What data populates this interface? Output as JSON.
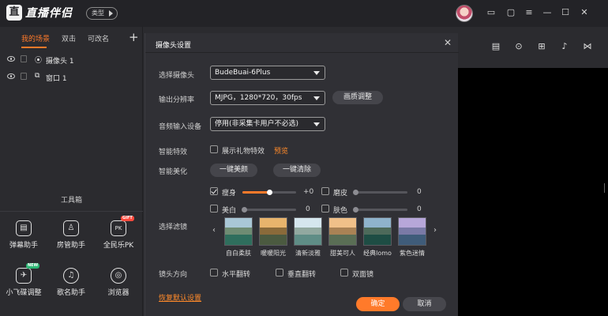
{
  "app": {
    "logo_glyph": "直",
    "name": "直播伴侣",
    "type_label": "类型"
  },
  "titlebar_icons": [
    "screen-icon",
    "window-icon",
    "menu-icon",
    "minimize-icon",
    "maximize-icon",
    "close-icon"
  ],
  "titlebar_glyphs": [
    "▭",
    "▢",
    "≡",
    "—",
    "☐",
    "✕"
  ],
  "scenes": {
    "tabs": [
      "我的场景",
      "双击",
      "可改名"
    ],
    "add": "+"
  },
  "sources": [
    {
      "icon": "⦿",
      "label": "摄像头 1"
    },
    {
      "icon": "⧉",
      "label": "窗口 1"
    }
  ],
  "toolbox": {
    "title": "工具箱",
    "tools": [
      {
        "glyph": "▤",
        "label": "弹幕助手",
        "badge": ""
      },
      {
        "glyph": "♙",
        "label": "房管助手",
        "badge": ""
      },
      {
        "glyph": "PK",
        "label": "全民乐PK",
        "badge": "GIFT"
      },
      {
        "glyph": "✈",
        "label": "小飞碟调整",
        "badge": "NEW"
      },
      {
        "glyph": "♫",
        "label": "歌名助手",
        "badge": ""
      },
      {
        "glyph": "◎",
        "label": "浏览器",
        "badge": ""
      }
    ]
  },
  "right_icons": [
    "▤",
    "⊙",
    "⊞",
    "♪",
    "⋈"
  ],
  "dialog": {
    "title": "摄像头设置",
    "close": "✕",
    "camera_label": "选择摄像头",
    "camera_value": "BudeBuai-6Plus",
    "resolution_label": "输出分辨率",
    "resolution_value": "MJPG，1280*720，30fps",
    "quality_button": "画质调整",
    "audio_label": "音频输入设备",
    "audio_value": "停用(非采集卡用户不必选)",
    "effects_label": "智能特效",
    "effects_checkbox": "展示礼物特效",
    "preview_link": "预览",
    "beauty_label": "智能美化",
    "beauty_button": "一键美颜",
    "clear_beauty_button": "一键清除",
    "sliders": [
      {
        "label": "瘦身",
        "checked": true,
        "value": "+0",
        "level": 0.5
      },
      {
        "label": "磨皮",
        "checked": false,
        "value": "0",
        "level": 0.0
      },
      {
        "label": "美白",
        "checked": false,
        "value": "0",
        "level": 0.0
      },
      {
        "label": "肤色",
        "checked": false,
        "value": "0",
        "level": 0.0
      }
    ],
    "filter_label": "选择滤镜",
    "filter_prev": "‹",
    "filter_next": "›",
    "filters": [
      {
        "name": "自白柔肤",
        "sky": "#a9c7d6",
        "mtn": "#6f8c73",
        "water": "#2f6e5d"
      },
      {
        "name": "暖暖阳光",
        "sky": "#e8b46c",
        "mtn": "#8a6a3a",
        "water": "#4b5a40"
      },
      {
        "name": "清新淡雅",
        "sky": "#d5e6ee",
        "mtn": "#92a9a0",
        "water": "#5f8d86"
      },
      {
        "name": "甜美可人",
        "sky": "#f0c089",
        "mtn": "#a98255",
        "water": "#5a6e55"
      },
      {
        "name": "经典lomo",
        "sky": "#8fb3cc",
        "mtn": "#4d6a5a",
        "water": "#1e4d44"
      },
      {
        "name": "紫色迷情",
        "sky": "#b7a7d9",
        "mtn": "#7a7aa6",
        "water": "#3f5c7a"
      }
    ],
    "mirror_label": "镜头方向",
    "mirror_options": [
      "水平翻转",
      "垂直翻转",
      "双面镜"
    ],
    "reset_link": "恢复默认设置",
    "confirm": "确定",
    "cancel": "取消"
  },
  "colors": {
    "accent": "#ff7a2a",
    "panel": "#303035",
    "background": "#2b2b2f"
  }
}
